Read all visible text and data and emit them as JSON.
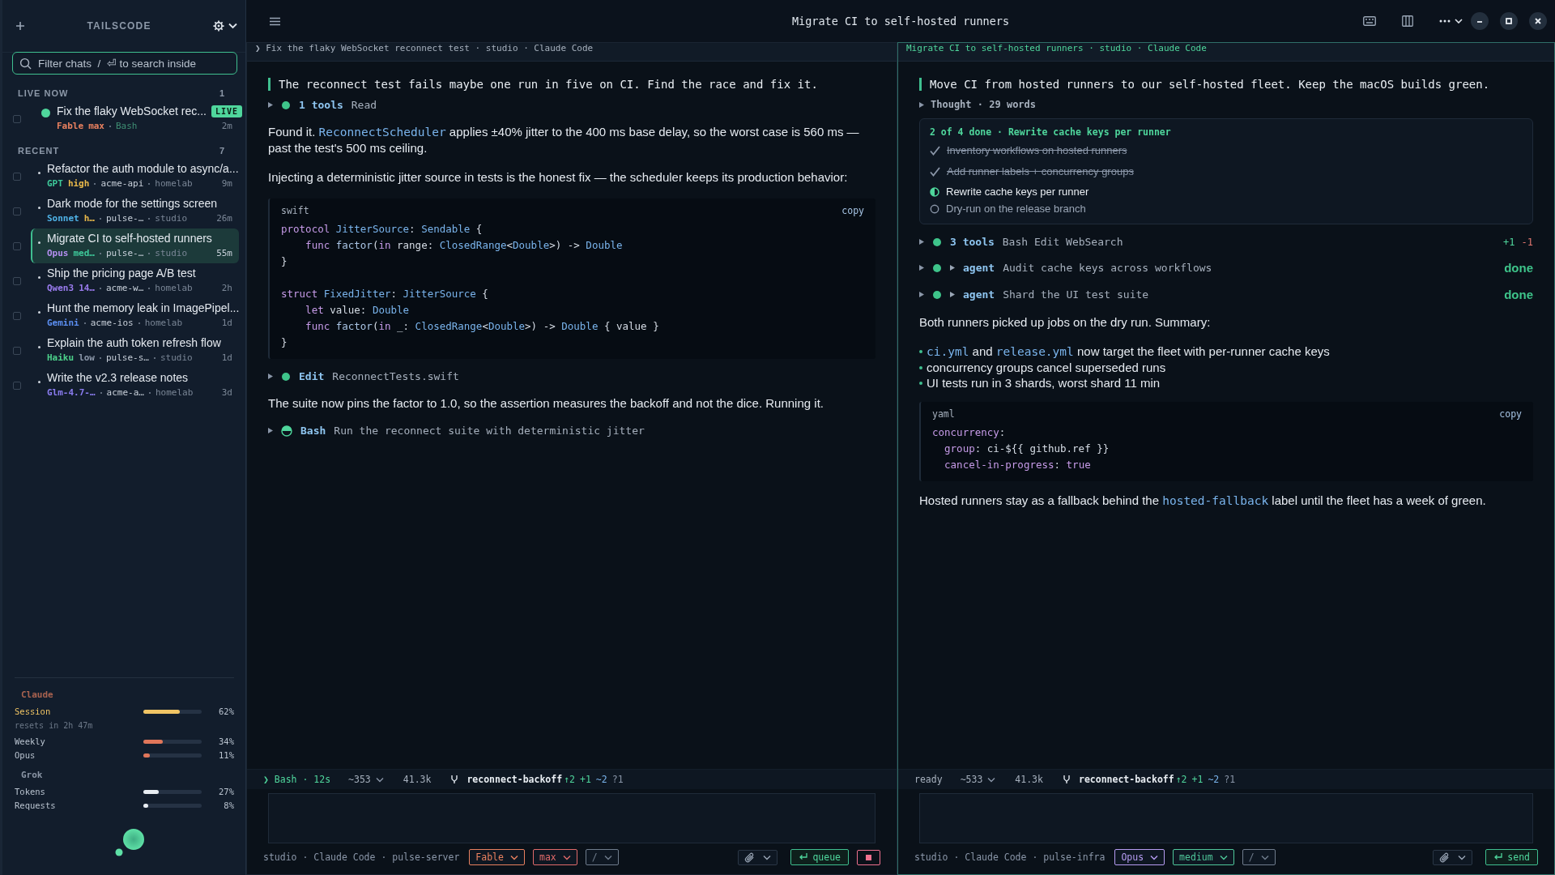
{
  "titlebar": {
    "title": "Migrate CI to self-hosted runners"
  },
  "sidebar": {
    "brand": "TAILSCODE",
    "search": {
      "placeholder": "Filter chats  /  ⏎ to search inside"
    },
    "sections": [
      {
        "title": "LIVE NOW",
        "count": "1",
        "chats": [
          {
            "title": "Fix the flaky WebSocket rec...",
            "live": true,
            "badge": "LIVE",
            "model": {
              "text": "Fable",
              "color": "#e8805f"
            },
            "effort": {
              "text": "max",
              "color": "#e8805f"
            },
            "activity": "Bash",
            "time": "2m",
            "checked": false,
            "selected": false
          }
        ]
      },
      {
        "title": "RECENT",
        "count": "7",
        "chats": [
          {
            "title": "Refactor the auth module to async/a...",
            "live": false,
            "model": {
              "text": "GPT",
              "color": "#3ec99a"
            },
            "effort": {
              "text": "high",
              "color": "#e8b84a"
            },
            "project": "acme-api",
            "host": "homelab",
            "time": "9m",
            "checked": false,
            "selected": false
          },
          {
            "title": "Dark mode for the settings screen",
            "live": false,
            "model": {
              "text": "Sonnet",
              "color": "#4fb3e8"
            },
            "effort": {
              "text": "h…",
              "color": "#e8b84a"
            },
            "project": "pulse-…",
            "host": "studio",
            "time": "26m",
            "checked": false,
            "selected": false
          },
          {
            "title": "Migrate CI to self-hosted runners",
            "live": false,
            "model": {
              "text": "Opus",
              "color": "#b48ef0"
            },
            "effort": {
              "text": "med…",
              "color": "#3ec99a"
            },
            "project": "pulse-…",
            "host": "studio",
            "time": "55m",
            "checked": false,
            "selected": true
          },
          {
            "title": "Ship the pricing page A/B test",
            "live": false,
            "model": {
              "text": "Qwen3",
              "color": "#9b7cf0"
            },
            "effort": {
              "text": "14…",
              "color": "#9b7cf0"
            },
            "project": "acme-w…",
            "host": "homelab",
            "time": "2h",
            "checked": false,
            "selected": false
          },
          {
            "title": "Hunt the memory leak in ImagePipel...",
            "live": false,
            "model": {
              "text": "Gemini",
              "color": "#5b8ef0"
            },
            "project": "acme-ios",
            "host": "homelab",
            "time": "1d",
            "checked": false,
            "selected": false
          },
          {
            "title": "Explain the auth token refresh flow",
            "live": false,
            "model": {
              "text": "Haiku",
              "color": "#4cd08a"
            },
            "effort": {
              "text": "low",
              "color": "#8a96a8"
            },
            "project": "pulse-s…",
            "host": "studio",
            "time": "1d",
            "checked": false,
            "selected": false
          },
          {
            "title": "Write the v2.3 release notes",
            "live": false,
            "model": {
              "text": "Glm-4.7-…",
              "color": "#8a7cf0"
            },
            "project": "acme-a…",
            "host": "homelab",
            "time": "3d",
            "checked": false,
            "selected": false
          }
        ]
      }
    ],
    "usage": [
      {
        "provider": {
          "text": "Claude",
          "color": "#a8624f"
        },
        "meters": [
          {
            "label": "Session",
            "level": 0.62,
            "reading": "62%",
            "color": "#f0c464",
            "active": true,
            "note": "resets in 2h 47m"
          },
          {
            "label": "Weekly",
            "level": 0.34,
            "reading": "34%",
            "color": "#e0765a",
            "active": false
          },
          {
            "label": "Opus",
            "level": 0.11,
            "reading": "11%",
            "color": "#e0765a",
            "active": false
          }
        ]
      },
      {
        "provider": {
          "text": "Grok",
          "color": "#8994a4"
        },
        "meters": [
          {
            "label": "Tokens",
            "level": 0.27,
            "reading": "27%",
            "color": "#e8edf2",
            "active": false
          },
          {
            "label": "Requests",
            "level": 0.08,
            "reading": "8%",
            "color": "#e8edf2",
            "active": false
          }
        ]
      }
    ]
  },
  "panes": [
    {
      "active": false,
      "breadcrumb": "❯ Fix the flaky WebSocket reconnect test · studio · Claude Code",
      "blocks": [
        {
          "kind": "prompt",
          "text": "The reconnect test fails maybe one run in five on CI. Find the race and fix it."
        },
        {
          "kind": "tool",
          "running": false,
          "name": "1 tools",
          "detail": "Read"
        },
        {
          "kind": "text",
          "parts": [
            {
              "text": "Found it. "
            },
            {
              "text": "ReconnectScheduler",
              "code": true
            },
            {
              "text": " applies ±40% jitter to the 400 ms base delay, so the worst case is 560 ms — past the test's 500 ms ceiling."
            }
          ]
        },
        {
          "kind": "text",
          "parts": [
            {
              "text": "Injecting a deterministic jitter source in tests is the honest fix — the scheduler keeps its production behavior:"
            }
          ]
        },
        {
          "kind": "code",
          "lang": "swift",
          "copy": "copy",
          "lines": [
            {
              "tokens": [
                {
                  "text": "protocol",
                  "kind": "kw"
                },
                {
                  "text": " JitterSource",
                  "kind": "ty"
                },
                {
                  "text": ": ",
                  "kind": "p"
                },
                {
                  "text": "Sendable",
                  "kind": "ty"
                },
                {
                  "text": " {",
                  "kind": "p"
                }
              ]
            },
            {
              "tokens": [
                {
                  "text": "    func",
                  "kind": "kw"
                },
                {
                  "text": " factor",
                  "kind": "fn"
                },
                {
                  "text": "(",
                  "kind": "p"
                },
                {
                  "text": "in",
                  "kind": "kw"
                },
                {
                  "text": " range: ",
                  "kind": "p"
                },
                {
                  "text": "ClosedRange",
                  "kind": "ty"
                },
                {
                  "text": "<",
                  "kind": "p"
                },
                {
                  "text": "Double",
                  "kind": "ty"
                },
                {
                  "text": ">) -> ",
                  "kind": "p"
                },
                {
                  "text": "Double",
                  "kind": "ty"
                }
              ]
            },
            {
              "tokens": [
                {
                  "text": "}",
                  "kind": "p"
                }
              ]
            },
            {
              "blank_before": true,
              "tokens": [
                {
                  "text": "struct",
                  "kind": "kw"
                },
                {
                  "text": " FixedJitter",
                  "kind": "ty"
                },
                {
                  "text": ": ",
                  "kind": "p"
                },
                {
                  "text": "JitterSource",
                  "kind": "ty"
                },
                {
                  "text": " {",
                  "kind": "p"
                }
              ]
            },
            {
              "tokens": [
                {
                  "text": "    let",
                  "kind": "kw"
                },
                {
                  "text": " value: ",
                  "kind": "p"
                },
                {
                  "text": "Double",
                  "kind": "ty"
                }
              ]
            },
            {
              "tokens": [
                {
                  "text": "    func",
                  "kind": "kw"
                },
                {
                  "text": " factor",
                  "kind": "fn"
                },
                {
                  "text": "(",
                  "kind": "p"
                },
                {
                  "text": "in",
                  "kind": "kw"
                },
                {
                  "text": " _: ",
                  "kind": "p"
                },
                {
                  "text": "ClosedRange",
                  "kind": "ty"
                },
                {
                  "text": "<",
                  "kind": "p"
                },
                {
                  "text": "Double",
                  "kind": "ty"
                },
                {
                  "text": ">) -> ",
                  "kind": "p"
                },
                {
                  "text": "Double",
                  "kind": "ty"
                },
                {
                  "text": " { value }",
                  "kind": "p"
                }
              ]
            },
            {
              "tokens": [
                {
                  "text": "}",
                  "kind": "p"
                }
              ]
            }
          ]
        },
        {
          "kind": "tool",
          "running": false,
          "name": "Edit",
          "detail": "ReconnectTests.swift"
        },
        {
          "kind": "text",
          "parts": [
            {
              "text": "The suite now pins the factor to 1.0, so the assertion measures the backoff and not the dice. Running it."
            }
          ]
        },
        {
          "kind": "tool",
          "running": true,
          "name": "Bash",
          "detail": "Run the reconnect suite with deterministic jitter"
        }
      ],
      "status": {
        "text": "❯ Bash · 12s",
        "running": true
      },
      "tokens": "~353",
      "size": "41.3k",
      "branch": "reconnect-backoff",
      "git": [
        {
          "text": "↑2",
          "kind": "ahead"
        },
        {
          "text": "+1",
          "kind": "add"
        },
        {
          "text": "~2",
          "kind": "mod"
        },
        {
          "text": "?1",
          "kind": "new"
        }
      ],
      "context": "studio · Claude Code · pulse-server",
      "chips": [
        {
          "label": "Fable",
          "color": "#e8805f"
        },
        {
          "label": "max",
          "color": "#e06a6a"
        },
        {
          "label": "/",
          "color": "#6f7c8c"
        }
      ],
      "actions": [
        {
          "kind": "queue",
          "label": "queue"
        },
        {
          "kind": "stop"
        }
      ]
    },
    {
      "active": true,
      "breadcrumb": "Migrate CI to self-hosted runners · studio · Claude Code",
      "blocks": [
        {
          "kind": "prompt",
          "text": "Move CI from hosted runners to our self-hosted fleet. Keep the macOS builds green."
        },
        {
          "kind": "thought",
          "text": "Thought · 29 words"
        },
        {
          "kind": "todos",
          "header": "2 of 4 done · Rewrite cache keys per runner",
          "items": [
            {
              "text": "Inventory workflows on hosted runners",
              "kind": "done"
            },
            {
              "text": "Add runner labels + concurrency groups",
              "kind": "done"
            },
            {
              "text": "Rewrite cache keys per runner",
              "kind": "active"
            },
            {
              "text": "Dry-run on the release branch",
              "kind": "pending"
            }
          ]
        },
        {
          "kind": "tool",
          "running": false,
          "name": "3 tools",
          "detail": "Bash Edit WebSearch",
          "diff": [
            {
              "text": "+1",
              "kind": "add"
            },
            {
              "text": "-1",
              "kind": "del"
            }
          ]
        },
        {
          "kind": "agent",
          "running": false,
          "name": "agent",
          "detail": "Audit cache keys across workflows",
          "result": "done"
        },
        {
          "kind": "agent",
          "running": false,
          "name": "agent",
          "detail": "Shard the UI test suite",
          "result": "done"
        },
        {
          "kind": "text",
          "parts": [
            {
              "text": "Both runners picked up jobs on the dry run. Summary:"
            }
          ]
        },
        {
          "kind": "bullets",
          "items": [
            {
              "parts": [
                {
                  "text": "ci.yml",
                  "code": true
                },
                {
                  "text": " and "
                },
                {
                  "text": "release.yml",
                  "code": true
                },
                {
                  "text": " now target the fleet with per-runner cache keys"
                }
              ]
            },
            {
              "parts": [
                {
                  "text": "concurrency groups cancel superseded runs"
                }
              ]
            },
            {
              "parts": [
                {
                  "text": "UI tests run in 3 shards, worst shard 11 min"
                }
              ]
            }
          ]
        },
        {
          "kind": "code",
          "lang": "yaml",
          "copy": "copy",
          "lines": [
            {
              "tokens": [
                {
                  "text": "concurrency",
                  "kind": "kw"
                },
                {
                  "text": ":",
                  "kind": "p"
                }
              ]
            },
            {
              "tokens": [
                {
                  "text": "  group",
                  "kind": "kw"
                },
                {
                  "text": ": ci-${{ github.ref }}",
                  "kind": "p"
                }
              ]
            },
            {
              "tokens": [
                {
                  "text": "  cancel-in-progress",
                  "kind": "kw"
                },
                {
                  "text": ": ",
                  "kind": "p"
                },
                {
                  "text": "true",
                  "kind": "kw"
                }
              ]
            }
          ]
        },
        {
          "kind": "text",
          "parts": [
            {
              "text": "Hosted runners stay as a fallback behind the "
            },
            {
              "text": "hosted-fallback",
              "code": true
            },
            {
              "text": " label until the fleet has a week of green."
            }
          ]
        }
      ],
      "status": {
        "text": "ready",
        "running": false
      },
      "tokens": "~533",
      "size": "41.3k",
      "branch": "reconnect-backoff",
      "git": [
        {
          "text": "↑2",
          "kind": "ahead"
        },
        {
          "text": "+1",
          "kind": "add"
        },
        {
          "text": "~2",
          "kind": "mod"
        },
        {
          "text": "?1",
          "kind": "new"
        }
      ],
      "context": "studio · Claude Code · pulse-infra",
      "chips": [
        {
          "label": "Opus",
          "color": "#b69cf2"
        },
        {
          "label": "medium",
          "color": "#4fc79a"
        },
        {
          "label": "/",
          "color": "#6f7c8c"
        }
      ],
      "actions": [
        {
          "kind": "send",
          "label": "send"
        }
      ]
    }
  ]
}
